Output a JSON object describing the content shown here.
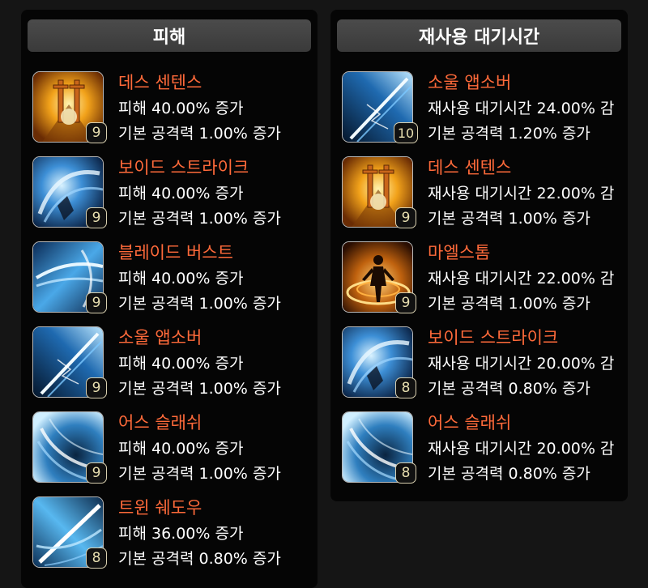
{
  "panels": [
    {
      "title": "피해",
      "entries": [
        {
          "name": "데스 센텐스",
          "line1": "피해 40.00% 증가",
          "line2": "기본 공격력 1.00% 증가",
          "level": "9",
          "icon": "death-sentence-icon"
        },
        {
          "name": "보이드 스트라이크",
          "line1": "피해 40.00% 증가",
          "line2": "기본 공격력 1.00% 증가",
          "level": "9",
          "icon": "void-strike-icon"
        },
        {
          "name": "블레이드 버스트",
          "line1": "피해 40.00% 증가",
          "line2": "기본 공격력 1.00% 증가",
          "level": "9",
          "icon": "blade-burst-icon"
        },
        {
          "name": "소울 앱소버",
          "line1": "피해 40.00% 증가",
          "line2": "기본 공격력 1.00% 증가",
          "level": "9",
          "icon": "soul-absorber-icon"
        },
        {
          "name": "어스 슬래쉬",
          "line1": "피해 40.00% 증가",
          "line2": "기본 공격력 1.00% 증가",
          "level": "9",
          "icon": "earth-slash-icon"
        },
        {
          "name": "트윈 쉐도우",
          "line1": "피해 36.00% 증가",
          "line2": "기본 공격력 0.80% 증가",
          "level": "8",
          "icon": "twin-shadow-icon"
        }
      ]
    },
    {
      "title": "재사용 대기시간",
      "entries": [
        {
          "name": "소울 앱소버",
          "line1": "재사용 대기시간 24.00% 감",
          "line2": "기본 공격력 1.20% 증가",
          "level": "10",
          "icon": "soul-absorber-icon"
        },
        {
          "name": "데스 센텐스",
          "line1": "재사용 대기시간 22.00% 감",
          "line2": "기본 공격력 1.00% 증가",
          "level": "9",
          "icon": "death-sentence-icon"
        },
        {
          "name": "마엘스톰",
          "line1": "재사용 대기시간 22.00% 감",
          "line2": "기본 공격력 1.00% 증가",
          "level": "9",
          "icon": "maelstrom-icon"
        },
        {
          "name": "보이드 스트라이크",
          "line1": "재사용 대기시간 20.00% 감",
          "line2": "기본 공격력 0.80% 증가",
          "level": "8",
          "icon": "void-strike-icon"
        },
        {
          "name": "어스 슬래쉬",
          "line1": "재사용 대기시간 20.00% 감",
          "line2": "기본 공격력 0.80% 증가",
          "level": "8",
          "icon": "earth-slash-icon"
        }
      ]
    }
  ],
  "colors": {
    "skill_name": "#ff6a3a",
    "text": "#ffffff",
    "badge": "#e8dfb0"
  }
}
